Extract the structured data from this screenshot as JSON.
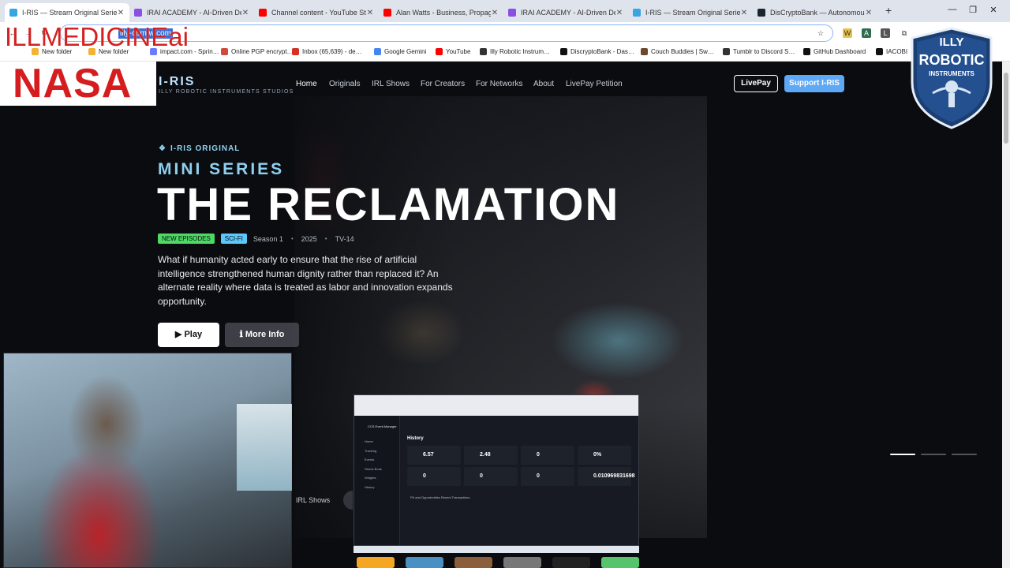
{
  "browser": {
    "tabs": [
      {
        "title": "I-RIS — Stream Original Series",
        "color": "#37a6e0",
        "active": true
      },
      {
        "title": "IRAI ACADEMY - AI-Driven Dev",
        "color": "#8a4fe3",
        "active": false
      },
      {
        "title": "Channel content - YouTube Stu",
        "color": "#ff0000",
        "active": false
      },
      {
        "title": "Alan Watts - Business, Propaga",
        "color": "#ff0000",
        "active": false
      },
      {
        "title": "IRAI ACADEMY - AI-Driven Dev",
        "color": "#8a4fe3",
        "active": false
      },
      {
        "title": "I-RIS — Stream Original Series",
        "color": "#37a6e0",
        "active": false
      },
      {
        "title": "DisCryptoBank — Autonomous",
        "color": "#1c2430",
        "active": false
      }
    ],
    "new_tab": "+",
    "url": "illy-com.w.com",
    "bookmarks": [
      {
        "label": "New folder",
        "color": "#f2b233"
      },
      {
        "label": "New folder",
        "color": "#f2b233"
      },
      {
        "label": "impact.com - Sprin…",
        "color": "#6a7cff"
      },
      {
        "label": "Online PGP encrypt…",
        "color": "#d04a3b"
      },
      {
        "label": "Inbox (65,639) - de…",
        "color": "#d93025"
      },
      {
        "label": "Google Gemini",
        "color": "#4285f4"
      },
      {
        "label": "YouTube",
        "color": "#ff0000"
      },
      {
        "label": "Illy Robotic Instrum…",
        "color": "#333333"
      },
      {
        "label": "DiscryptoBank - Das…",
        "color": "#111111"
      },
      {
        "label": "Couch Buddies | Sw…",
        "color": "#6b4a2b"
      },
      {
        "label": "Tumblr to Discord S…",
        "color": "#333333"
      },
      {
        "label": "GitHub Dashboard",
        "color": "#111111"
      },
      {
        "label": "IACOBI",
        "color": "#111111"
      }
    ]
  },
  "overlays": {
    "ill_text": "ILLMEDICINEai",
    "nasa_text": "NASA",
    "badge_top": "ILLY",
    "badge_mid": "ROBOTIC",
    "badge_bottom": "INSTRUMENTS"
  },
  "site": {
    "logo": "I-RIS",
    "logo_sub": "ILLY ROBOTIC INSTRUMENTS STUDIOS",
    "nav": [
      "Home",
      "Originals",
      "IRL Shows",
      "For Creators",
      "For Networks",
      "About",
      "LivePay Petition"
    ],
    "livepay_label": "LivePay",
    "support_label": "Support I-RIS"
  },
  "hero": {
    "eyebrow": "I-RIS ORIGINAL",
    "subtitle": "MINI SERIES",
    "title": "THE RECLAMATION",
    "badges": [
      {
        "label": "NEW EPISODES",
        "color": "#4cd964"
      },
      {
        "label": "SCI-FI",
        "color": "#5ac8fa"
      }
    ],
    "meta": [
      "Season 1",
      "2025",
      "TV-14"
    ],
    "description": "What if humanity acted early to ensure that the rise of artificial intelligence strengthened human dignity rather than replaced it? An alternate reality where data is treated as labor and innovation expands opportunity.",
    "play_label": "▶ Play",
    "info_label": "ℹ More Info"
  },
  "row": {
    "irl_label": "IRL Shows"
  },
  "mini_app": {
    "title": "CCS Event Manager",
    "heading": "History",
    "sidebar": [
      "Home",
      "Tracking",
      "Events",
      "Stores Book",
      "Widgets",
      "History"
    ],
    "cards": [
      {
        "value": "6.57"
      },
      {
        "value": "2.48"
      },
      {
        "value": "0"
      },
      {
        "value": "0%"
      },
      {
        "value": "0"
      },
      {
        "value": "0"
      },
      {
        "value": "0"
      },
      {
        "value": "0.010969831698"
      }
    ],
    "tabs": "Fill and Opportunities    Recent Transactions"
  }
}
